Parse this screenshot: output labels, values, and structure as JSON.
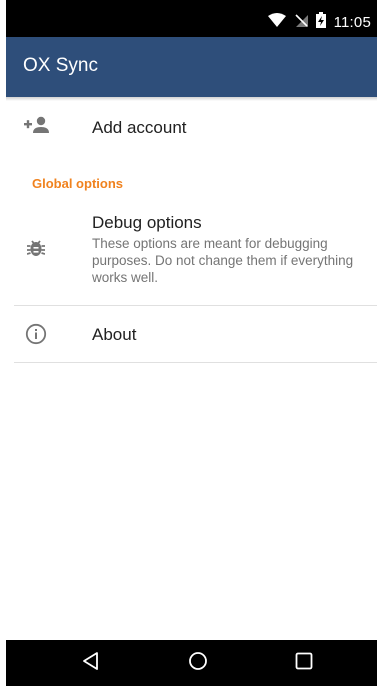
{
  "status_bar": {
    "time": "11:05",
    "icons": [
      "wifi-icon",
      "no-sim-icon",
      "battery-charging-icon"
    ]
  },
  "app_bar": {
    "title": "OX Sync"
  },
  "settings": {
    "add_account": {
      "label": "Add account",
      "icon": "add-person-icon"
    },
    "section_header": "Global options",
    "debug_options": {
      "title": "Debug options",
      "summary": "These options are meant for debugging purposes. Do not change them if everything works well.",
      "icon": "bug-icon"
    },
    "about": {
      "label": "About",
      "icon": "info-icon"
    }
  },
  "nav_bar": {
    "buttons": [
      "back-icon",
      "home-icon",
      "recents-icon"
    ]
  },
  "colors": {
    "app_bar": "#2e4e7a",
    "accent": "#f0821e",
    "status_bar": "#000000",
    "nav_bar": "#000000"
  }
}
